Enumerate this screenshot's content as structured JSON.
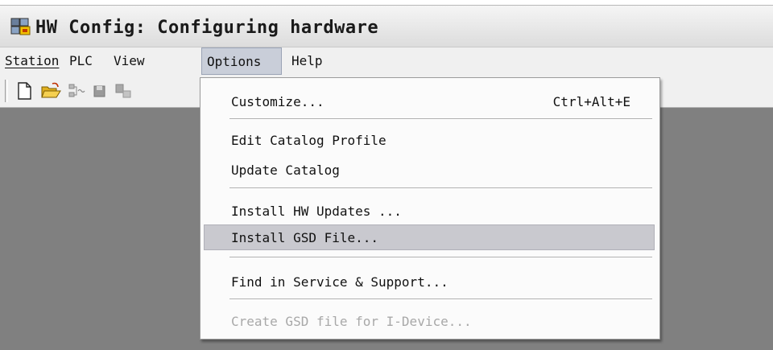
{
  "window": {
    "title": "HW Config: Configuring hardware"
  },
  "menubar": {
    "items": [
      {
        "label": "Station"
      },
      {
        "label": "PLC"
      },
      {
        "label": "View"
      },
      {
        "label": "Options"
      },
      {
        "label": "Help"
      }
    ]
  },
  "toolbar": {
    "buttons": [
      {
        "icon": "new-document-icon"
      },
      {
        "icon": "open-folder-icon"
      },
      {
        "icon": "network-icon"
      },
      {
        "icon": "save-icon"
      },
      {
        "icon": "download-icon"
      }
    ]
  },
  "options_menu": {
    "items": [
      {
        "label": "Customize...",
        "shortcut": "Ctrl+Alt+E"
      },
      {
        "label": "Edit Catalog Profile"
      },
      {
        "label": "Update Catalog"
      },
      {
        "label": "Install HW Updates ..."
      },
      {
        "label": "Install GSD File..."
      },
      {
        "label": "Find in Service & Support..."
      },
      {
        "label": "Create GSD file for I-Device..."
      }
    ]
  }
}
